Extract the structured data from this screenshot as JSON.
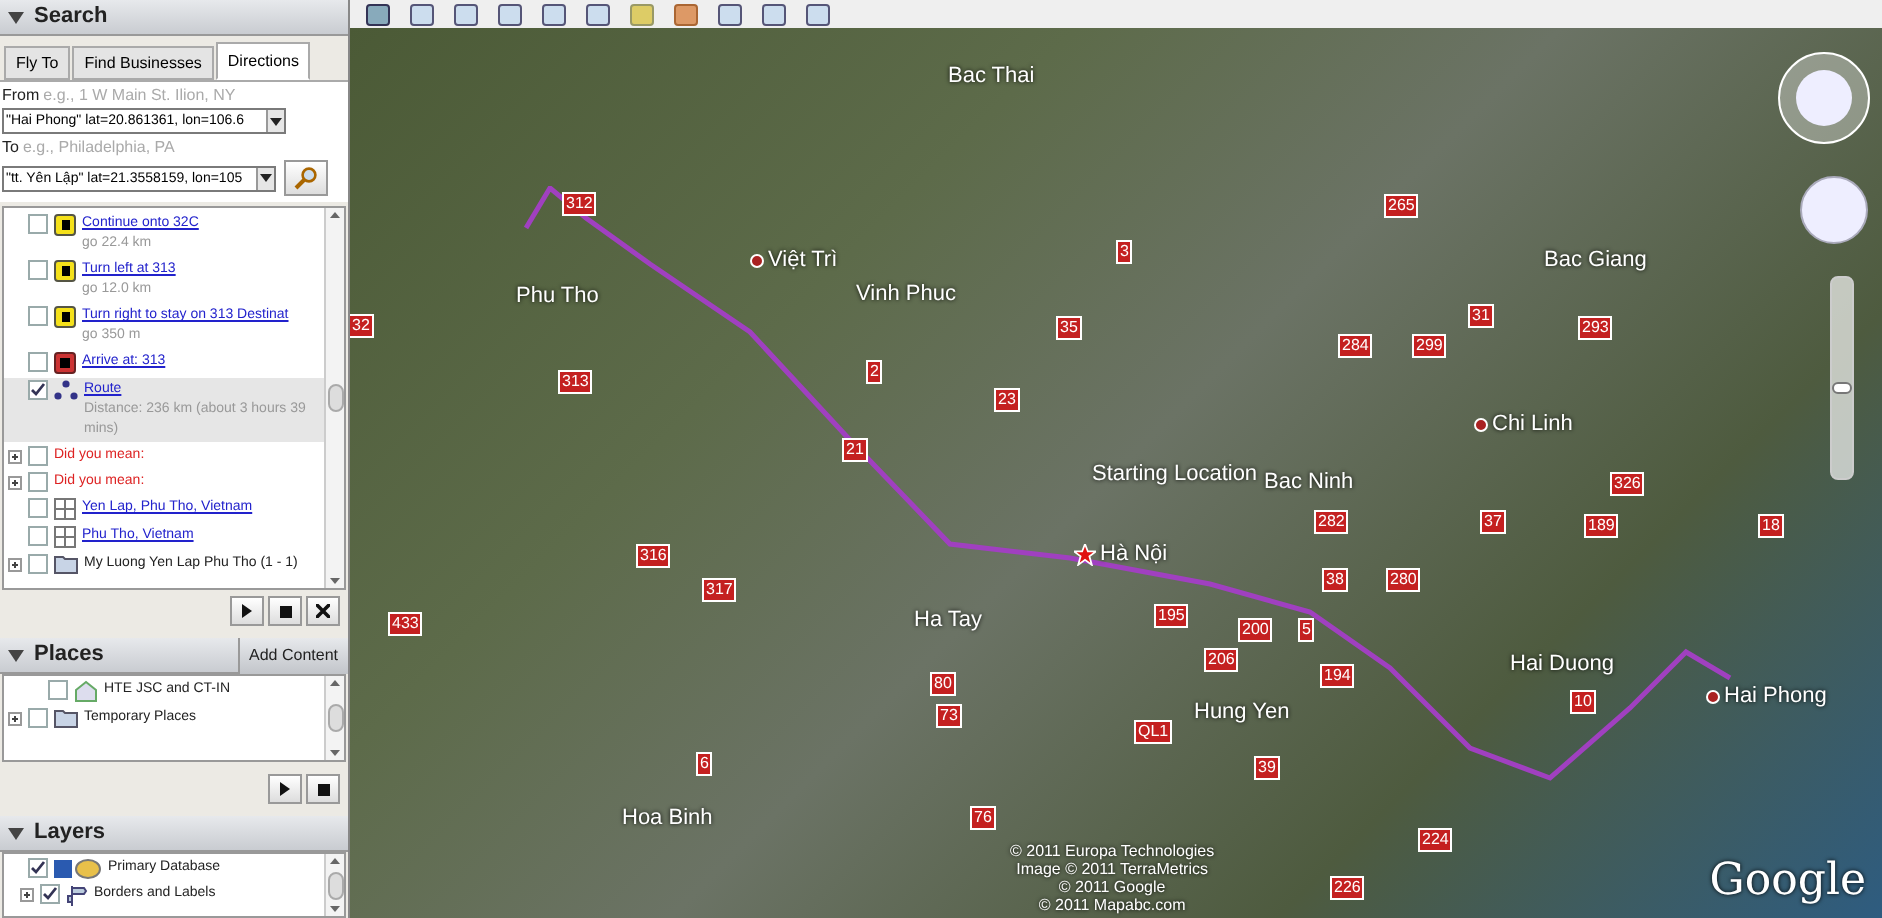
{
  "search": {
    "title": "Search",
    "tabs": [
      {
        "label": "Fly To",
        "selected": false
      },
      {
        "label": "Find Businesses",
        "selected": false
      },
      {
        "label": "Directions",
        "selected": true
      }
    ],
    "from": {
      "label": "From",
      "hint": "e.g., 1 W Main St. Ilion, NY",
      "value": "\"Hai Phong\" lat=20.861361, lon=106.6"
    },
    "to": {
      "label": "To",
      "hint": "e.g., Philadelphia, PA",
      "value": "\"tt. Yên Lập\" lat=21.3558159, lon=105"
    },
    "items": [
      {
        "kind": "step",
        "text": "Continue onto 32C",
        "detail": "go 22.4 km",
        "checked": false
      },
      {
        "kind": "step",
        "text": "Turn left at 313",
        "detail": "go 12.0 km",
        "checked": false
      },
      {
        "kind": "step",
        "text": "Turn right to stay on 313 Destinat",
        "detail": "go 350 m",
        "checked": false
      },
      {
        "kind": "arrive",
        "text": "Arrive at: 313",
        "checked": false
      },
      {
        "kind": "route",
        "text": "Route",
        "detail": "Distance: 236 km (about 3 hours 39 mins)",
        "checked": true,
        "selected": true
      },
      {
        "kind": "suggestion",
        "text": "Did you mean:",
        "checked": false
      },
      {
        "kind": "suggestion",
        "text": "Did you mean:",
        "checked": false
      },
      {
        "kind": "result",
        "text": "Yen Lap, Phu Tho, Vietnam",
        "checked": false
      },
      {
        "kind": "result",
        "text": "Phu Tho, Vietnam",
        "checked": false
      },
      {
        "kind": "folder",
        "text": "My Luong Yen Lap Phu Tho (1 - 1)",
        "checked": false
      }
    ]
  },
  "places": {
    "title": "Places",
    "add_button": "Add Content",
    "items": [
      {
        "kind": "place",
        "text": "HTE JSC and CT-IN",
        "checked": false
      },
      {
        "kind": "folder",
        "text": "Temporary Places",
        "checked": false
      }
    ]
  },
  "layers": {
    "title": "Layers",
    "items": [
      {
        "kind": "database",
        "text": "Primary Database",
        "checked": true
      },
      {
        "kind": "labels",
        "text": "Borders and Labels",
        "checked": true
      }
    ]
  },
  "map": {
    "places": [
      "Bac Thai",
      "Việt Trì",
      "Vinh Phuc",
      "Phu Tho",
      "Bac Giang",
      "Chi Linh",
      "Starting Location",
      "Bac Ninh",
      "Hà Nội",
      "Ha Tay",
      "Hung Yen",
      "Hai Duong",
      "Hai Phong",
      "Hoa Binh"
    ],
    "roads": [
      "312",
      "3",
      "265",
      "32",
      "35",
      "2",
      "31",
      "293",
      "284",
      "299",
      "313",
      "23",
      "326",
      "21",
      "282",
      "37",
      "189",
      "18",
      "316",
      "317",
      "38",
      "280",
      "433",
      "195",
      "200",
      "5",
      "206",
      "194",
      "80",
      "73",
      "10",
      "QL1",
      "39",
      "6",
      "76",
      "224",
      "226"
    ],
    "attribution": [
      "© 2011 Europa Technologies",
      "Image © 2011 TerraMetrics",
      "© 2011 Google",
      "© 2011 Mapabc.com"
    ],
    "logo": "Google",
    "zoom": {
      "level": 0.45
    }
  }
}
